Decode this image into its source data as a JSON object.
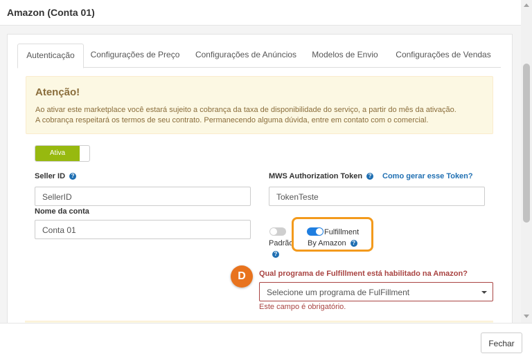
{
  "modal": {
    "title": "Amazon (Conta 01)"
  },
  "tabs": [
    {
      "label": "Autenticação",
      "active": true
    },
    {
      "label": "Configurações de Preço",
      "active": false
    },
    {
      "label": "Configurações de Anúncios",
      "active": false
    },
    {
      "label": "Modelos de Envio",
      "active": false
    },
    {
      "label": "Configurações de Vendas",
      "active": false
    }
  ],
  "alert": {
    "title": "Atenção!",
    "line1": "Ao ativar este marketplace você estará sujeito a cobrança da taxa de disponibilidade do serviço, a partir do mês da ativação.",
    "line2": "A cobrança respeitará os termos de seu contrato. Permanecendo alguma dúvida, entre em contato com o comercial."
  },
  "status_switch": {
    "label": "Ativa",
    "on": true
  },
  "form": {
    "seller_id_label": "Seller ID",
    "seller_id_value": "SellerID",
    "account_name_label": "Nome da conta",
    "account_name_value": "Conta 01",
    "mws_label": "MWS Authorization Token",
    "mws_help_link": "Como gerar esse Token?",
    "mws_value": "TokenTeste",
    "default_toggle_label": "Padrão",
    "default_toggle_on": false,
    "fba_toggle_label_1": "Fulfillment",
    "fba_toggle_label_2": "By Amazon",
    "fba_toggle_on": true,
    "badge_letter": "D",
    "fulfillment_question": "Qual programa de Fulfillment está habilitado na Amazon?",
    "fulfillment_select_placeholder": "Selecione um programa de FulFillment",
    "required_error": "Este campo é obrigatório."
  },
  "footer": {
    "close_label": "Fechar"
  },
  "colors": {
    "accent_green": "#97b90f",
    "toggle_blue": "#1f7ee0",
    "highlight_orange": "#f39a1c",
    "badge_orange": "#e8731e",
    "error_red": "#a94442",
    "link_blue": "#1f6fb2"
  }
}
